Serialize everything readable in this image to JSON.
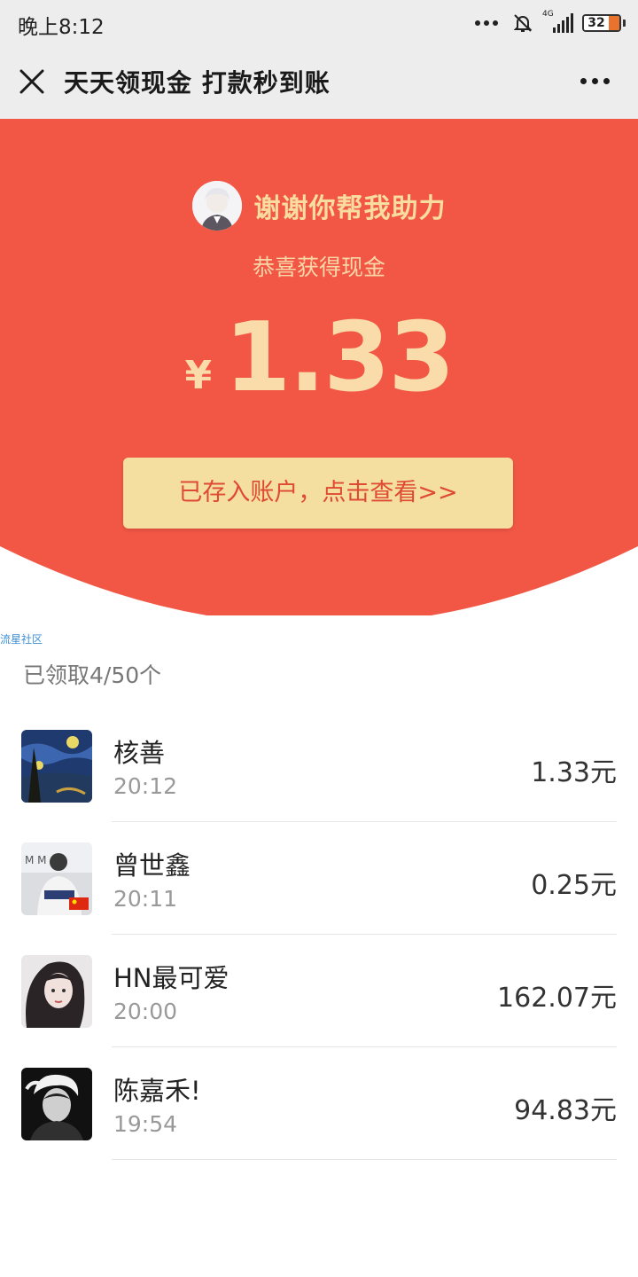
{
  "status_bar": {
    "time": "晚上8:12",
    "network_label": "4G",
    "battery": "32"
  },
  "nav": {
    "title": "天天领现金 打款秒到账"
  },
  "hero": {
    "helper_text": "谢谢你帮我助力",
    "subtitle": "恭喜获得现金",
    "currency": "¥",
    "amount": "1.33",
    "button_label": "已存入账户，点击查看>>",
    "bg_color": "#f25745"
  },
  "watermark": "流星社区",
  "claimed_text": "已领取4/50个",
  "records": [
    {
      "name": "核善",
      "time": "20:12",
      "amount": "1.33元",
      "avatar": "starry-night-avatar"
    },
    {
      "name": "曾世鑫",
      "time": "20:11",
      "amount": "0.25元",
      "avatar": "patagonia-shirt-avatar"
    },
    {
      "name": "HN最可爱",
      "time": "20:00",
      "amount": "162.07元",
      "avatar": "girl-portrait-avatar"
    },
    {
      "name": "陈嘉禾!",
      "time": "19:54",
      "amount": "94.83元",
      "avatar": "bw-portrait-avatar"
    }
  ]
}
